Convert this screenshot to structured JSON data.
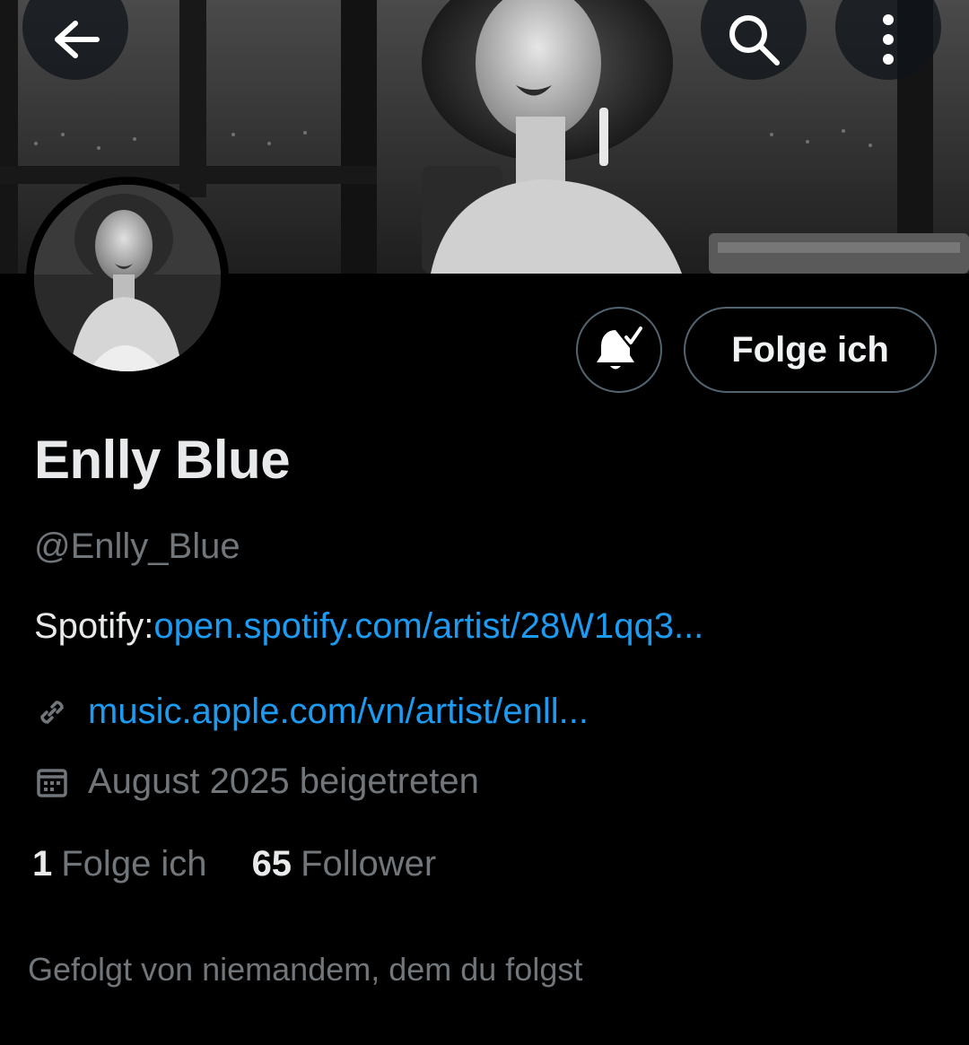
{
  "header": {
    "back_icon": "arrow-left-icon",
    "search_icon": "search-icon",
    "more_icon": "more-vertical-icon"
  },
  "profile": {
    "display_name": "Enlly Blue",
    "handle": "@Enlly_Blue",
    "bio_prefix": "Spotify:",
    "bio_link": "open.spotify.com/artist/28W1qq3...",
    "website": "music.apple.com/vn/artist/enll...",
    "joined": "August 2025 beigetreten",
    "following_count": "1",
    "following_label": "Folge ich",
    "followers_count": "65",
    "followers_label": "Follower",
    "followed_by_text": "Gefolgt von niemandem, dem du folgst"
  },
  "actions": {
    "notify_icon": "bell-check-icon",
    "follow_label": "Folge ich"
  },
  "icons": {
    "website": "link-icon",
    "joined": "calendar-icon"
  },
  "colors": {
    "background": "#000000",
    "text_primary": "#e7e9ea",
    "text_secondary": "#71767b",
    "link": "#1d9bf0",
    "border": "#536471"
  }
}
